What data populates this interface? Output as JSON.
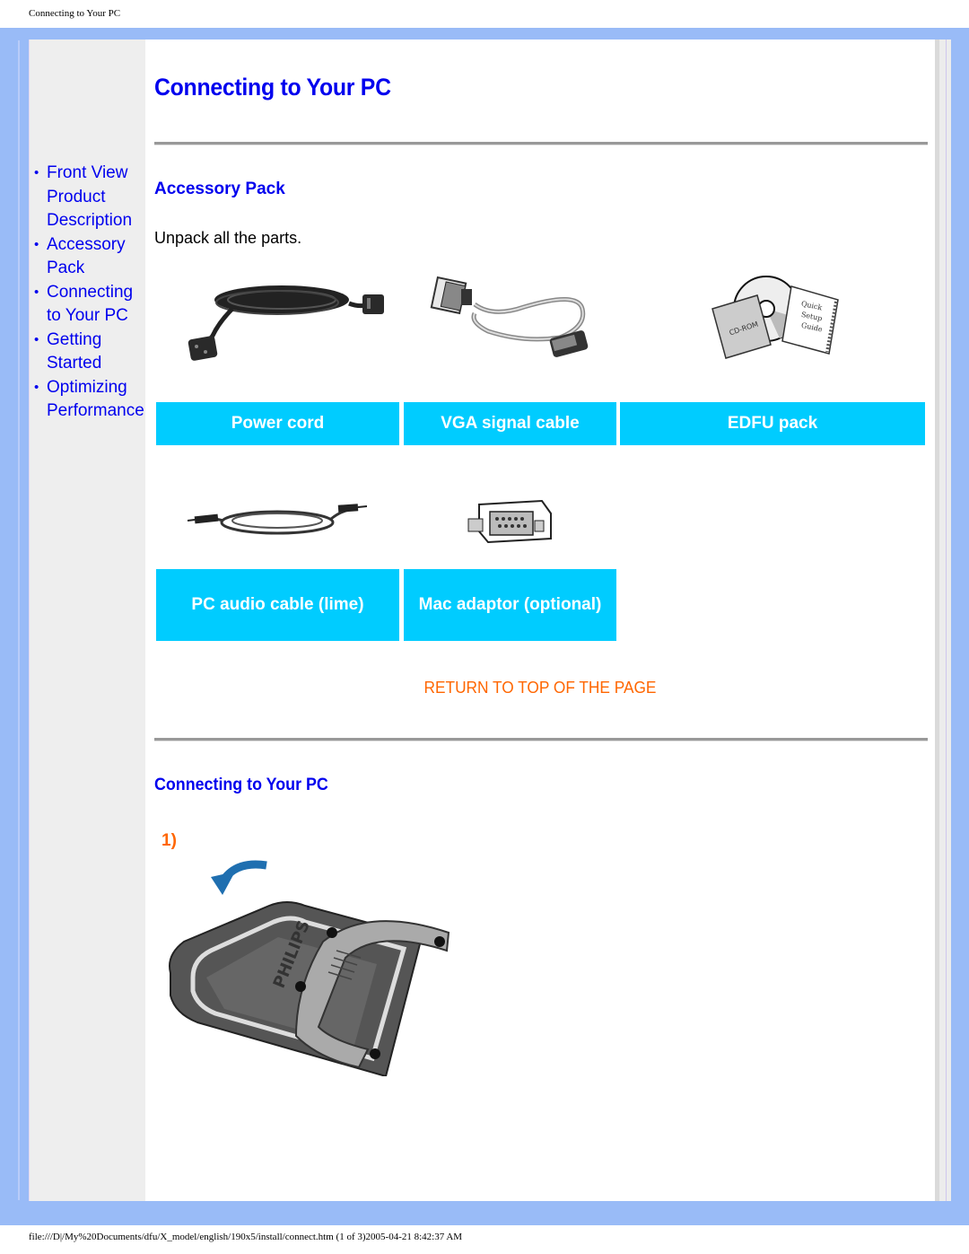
{
  "print_header": "Connecting to Your PC",
  "print_footer": "file:///D|/My%20Documents/dfu/X_model/english/190x5/install/connect.htm (1 of 3)2005-04-21 8:42:37 AM",
  "colors": {
    "frame": "#99bbf7",
    "sidebar": "#eeeeee",
    "link": "#0000ee",
    "accent_orange": "#ff6600",
    "label_bg": "#00ccff"
  },
  "sidebar": {
    "bullet": "•",
    "items": [
      {
        "label": "Front View Product Description"
      },
      {
        "label": "Accessory Pack"
      },
      {
        "label": "Connecting to Your PC"
      },
      {
        "label": "Getting Started"
      },
      {
        "label": "Optimizing Performance"
      }
    ]
  },
  "main": {
    "title": "Connecting to Your PC",
    "accessory_section": {
      "heading": "Accessory Pack",
      "intro": "Unpack all the parts.",
      "items": [
        {
          "label": "Power cord",
          "icon": "power-cord-image"
        },
        {
          "label": "VGA signal cable",
          "icon": "vga-cable-image"
        },
        {
          "label": "EDFU pack",
          "icon": "edfu-pack-image"
        },
        {
          "label": "PC audio cable (lime)",
          "icon": "audio-cable-image"
        },
        {
          "label": "Mac adaptor (optional)",
          "icon": "mac-adaptor-image"
        }
      ]
    },
    "return_link": "RETURN TO TOP OF THE PAGE",
    "connect_section": {
      "heading": "Connecting to Your PC",
      "steps": [
        {
          "number": "1)",
          "illustration": "monitor-base-rotate-image",
          "logo_text": "PHILIPS"
        }
      ]
    }
  }
}
